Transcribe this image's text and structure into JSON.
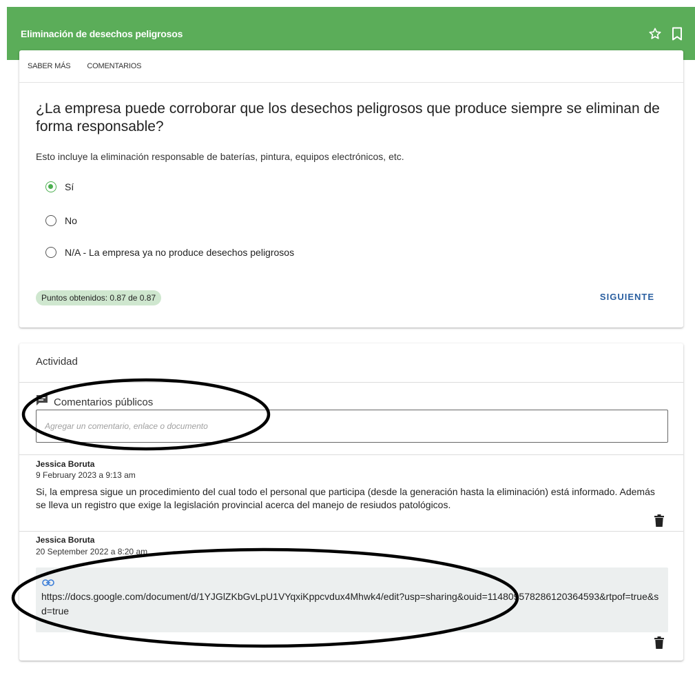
{
  "header": {
    "title": "Eliminación de desechos peligrosos",
    "star_icon": "star-outline-icon",
    "bookmark_icon": "bookmark-outline-icon",
    "bg_color": "#5bad59"
  },
  "tabs": [
    {
      "label": "SABER MÁS"
    },
    {
      "label": "COMENTARIOS"
    }
  ],
  "question": {
    "title": "¿La empresa puede corroborar que los desechos peligrosos que produce siempre se eliminan de forma responsable?",
    "hint": "Esto incluye la eliminación responsable de baterías, pintura, equipos electrónicos, etc.",
    "options": [
      {
        "label": "Sí",
        "selected": true
      },
      {
        "label": "No",
        "selected": false
      },
      {
        "label": "N/A - La empresa ya no produce desechos peligrosos",
        "selected": false
      }
    ],
    "score": "Puntos obtenidos: 0.87 de 0.87",
    "next_label": "SIGUIENTE",
    "accent_color": "#4caf50"
  },
  "activity": {
    "title": "Actividad",
    "public_comments_label": "Comentarios públicos",
    "comment_placeholder": "Agregar un comentario, enlace o documento",
    "comments": [
      {
        "author": "Jessica Boruta",
        "date": "9 February 2023 a 9:13 am",
        "text": "Si, la empresa sigue un procedimiento del cual todo el personal que participa (desde la generación hasta la eliminación) está informado. Además se lleva un registro que exige la legislación provincial acerca del manejo de resiudos patológicos."
      },
      {
        "author": "Jessica Boruta",
        "date": "20 September 2022 a 8:20 am",
        "link": "https://docs.google.com/document/d/1YJGlZKbGvLpU1VYqxiKppcvdux4Mhwk4/edit?usp=sharing&ouid=114809578286120364593&rtpof=true&sd=true"
      }
    ]
  }
}
